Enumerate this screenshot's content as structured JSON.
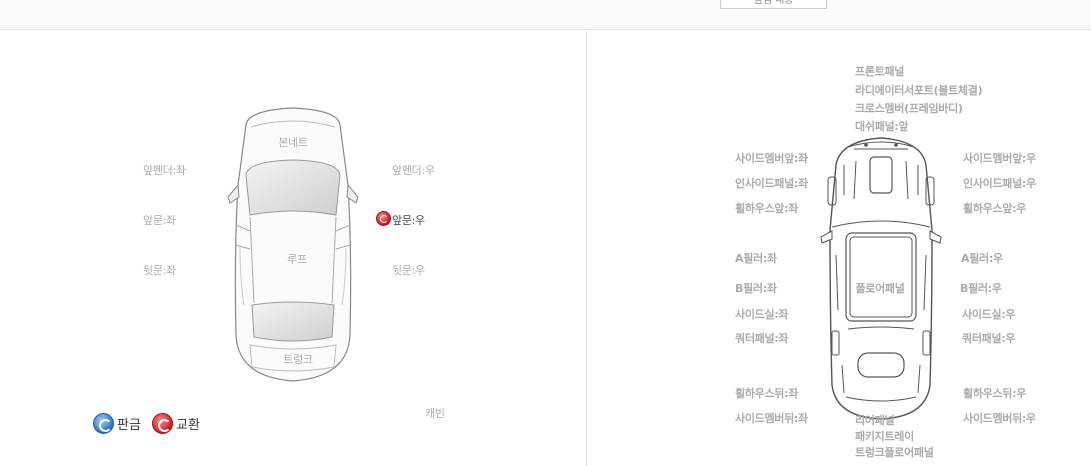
{
  "topbar": {
    "button_label": "점검 내용"
  },
  "left_panel": {
    "part_labels": {
      "bonnet": "본네트",
      "roof": "루프",
      "trunk": "트렁크",
      "front_fender_left": "앞펜더:좌",
      "front_fender_right": "앞펜더:우",
      "front_door_left": "앞문:좌",
      "front_door_right": "앞문:우",
      "rear_door_left": "뒷문:좌",
      "rear_door_right": "뒷문:우",
      "cabin": "캐빈"
    },
    "legend": {
      "sheet_metal": "판금",
      "replace": "교환"
    },
    "status_colors": {
      "replace": "#d4151b",
      "sheet_metal": "#2a6fc2"
    }
  },
  "right_panel": {
    "part_labels": {
      "front_panel": "프론트패널",
      "radiator_support": "라디에이터서포트(볼트체결)",
      "cross_member": "크로스멤버(프레임바디)",
      "dash_panel_front": "대쉬패널:앞",
      "side_member_front_left": "사이드멤버앞:좌",
      "side_member_front_right": "사이드멤버앞:우",
      "inside_panel_left": "인사이드패널:좌",
      "inside_panel_right": "인사이드패널:우",
      "wheelhouse_front_left": "휠하우스앞:좌",
      "wheelhouse_front_right": "휠하우스앞:우",
      "a_pillar_left": "A필러:좌",
      "a_pillar_right": "A필러:우",
      "b_pillar_left": "B필러:좌",
      "b_pillar_right": "B필러:우",
      "floor_panel": "플로어패널",
      "side_sill_left": "사이드실:좌",
      "side_sill_right": "사이드실:우",
      "quarter_panel_left": "쿼터패널:좌",
      "quarter_panel_right": "쿼터패널:우",
      "wheelhouse_rear_left": "휠하우스뒤:좌",
      "wheelhouse_rear_right": "휠하우스뒤:우",
      "side_member_rear_left": "사이드멤버뒤:좌",
      "side_member_rear_right": "사이드멤버뒤:우",
      "rear_panel": "리어패널",
      "package_tray": "패키지트레이",
      "trunk_floor_panel": "트렁크플로어패널"
    }
  }
}
